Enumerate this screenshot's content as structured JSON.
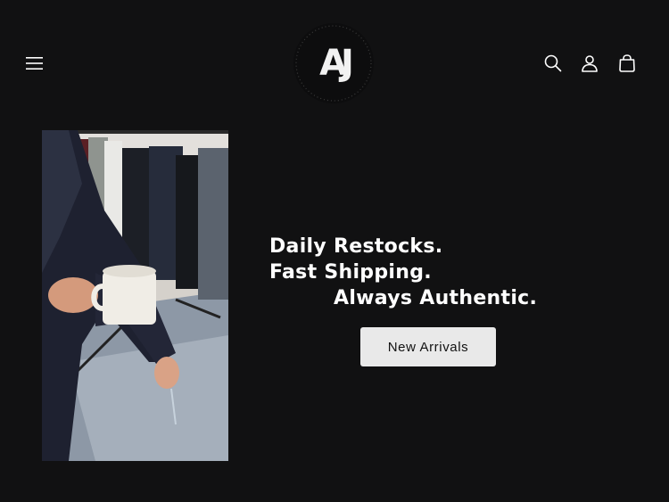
{
  "header": {
    "menu_icon": "hamburger-menu-icon",
    "logo_text": "AJ",
    "search_icon": "search-icon",
    "account_icon": "user-icon",
    "cart_icon": "shopping-bag-icon"
  },
  "hero": {
    "lines": [
      "Daily Restocks.",
      "Fast Shipping.",
      "Always Authentic."
    ],
    "cta_label": "New Arrivals"
  },
  "colors": {
    "background": "#111112",
    "text": "#ffffff",
    "button_bg": "#e9e9e9",
    "button_text": "#121212"
  }
}
